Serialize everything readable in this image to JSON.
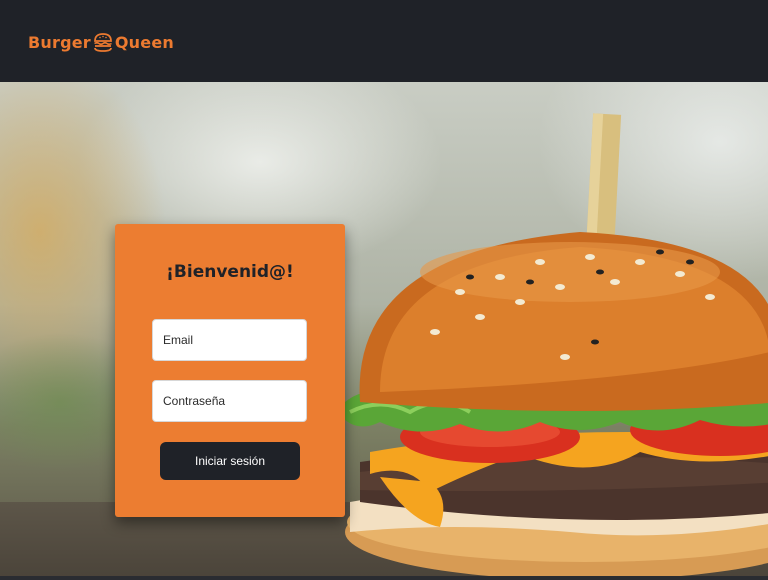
{
  "header": {
    "logo_left": "Burger",
    "logo_right": "Queen",
    "logo_icon": "burger-icon",
    "accent_color": "#ec7a30",
    "background_color": "#1f2228"
  },
  "hero": {
    "image": "burger-photo"
  },
  "login": {
    "title": "¡Bienvenid@!",
    "email_placeholder": "Email",
    "email_value": "",
    "password_placeholder": "Contraseña",
    "password_value": "",
    "submit_label": "Iniciar sesión",
    "card_color": "#ec7d31",
    "button_color": "#1f2228"
  }
}
